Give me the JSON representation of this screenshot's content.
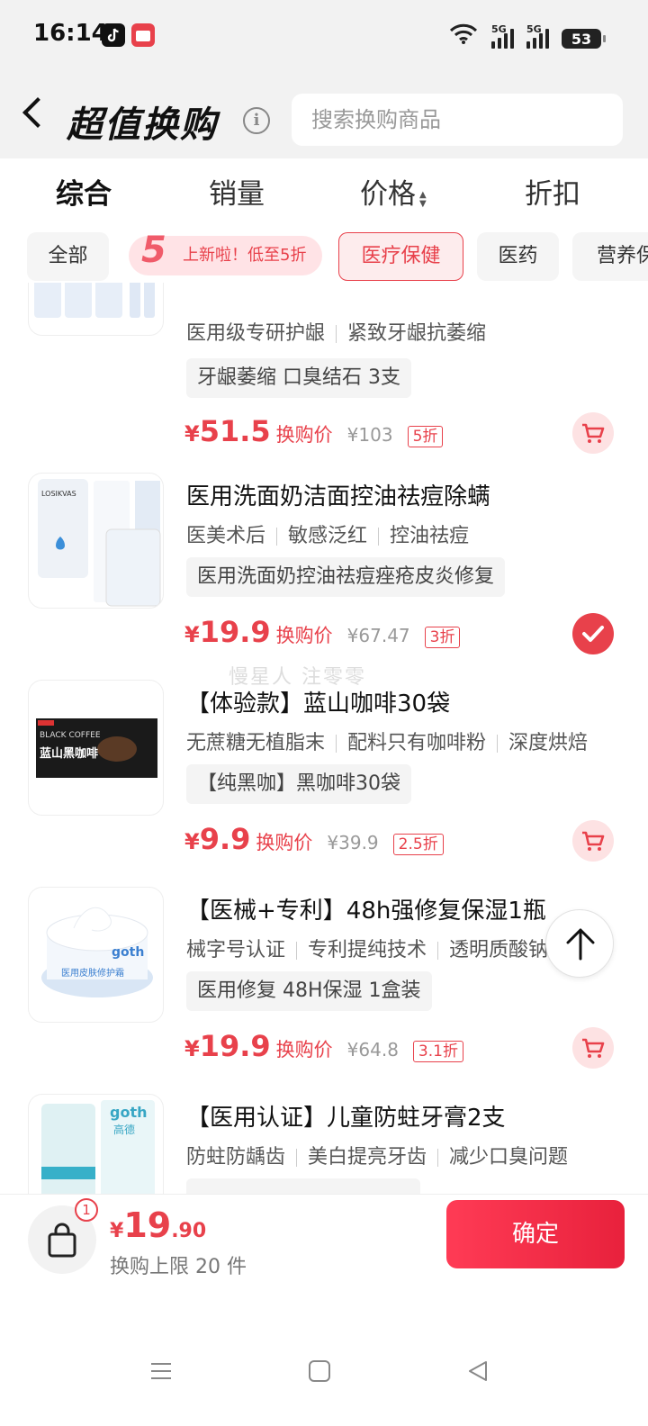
{
  "status_bar": {
    "time": "16:14",
    "battery": "53",
    "signal1": "5G",
    "signal2": "5G"
  },
  "header": {
    "title": "超值换购",
    "info_icon": "info-icon",
    "search_placeholder": "搜索换购商品"
  },
  "sort_tabs": [
    {
      "label": "综合",
      "active": true
    },
    {
      "label": "销量",
      "active": false
    },
    {
      "label": "价格",
      "active": false
    },
    {
      "label": "折扣",
      "active": false
    }
  ],
  "categories": {
    "all": "全部",
    "promo": "上新啦！低至5折",
    "promo_badge": "5",
    "medical": "医疗保健",
    "medicine": "医药",
    "nutrition": "营养保"
  },
  "products": [
    {
      "name": "",
      "tags": [
        "医用级专研护龈",
        "紧致牙龈抗萎缩"
      ],
      "chip": "牙龈萎缩 口臭结石 3支",
      "price_int": "51.5",
      "price_label": "换购价",
      "orig_price": "¥103",
      "discount": "5折",
      "selected": false
    },
    {
      "name": "医用洗面奶洁面控油祛痘除螨",
      "tags": [
        "医美术后",
        "敏感泛红",
        "控油祛痘"
      ],
      "chip": "医用洗面奶控油祛痘痤疮皮炎修复",
      "price_int": "19.9",
      "price_label": "换购价",
      "orig_price": "¥67.47",
      "discount": "3折",
      "selected": true
    },
    {
      "name": "【体验款】蓝山咖啡30袋",
      "tags": [
        "无蔗糖无植脂末",
        "配料只有咖啡粉",
        "深度烘焙"
      ],
      "chip": "【纯黑咖】黑咖啡30袋",
      "price_int": "9.9",
      "price_label": "换购价",
      "orig_price": "¥39.9",
      "discount": "2.5折",
      "selected": false
    },
    {
      "name": "【医械+专利】48h强修复保湿1瓶",
      "tags": [
        "械字号认证",
        "专利提纯技术",
        "透明质酸钠"
      ],
      "chip": "医用修复 48H保湿 1盒装",
      "price_int": "19.9",
      "price_label": "换购价",
      "orig_price": "¥64.8",
      "discount": "3.1折",
      "selected": false
    },
    {
      "name": "【医用认证】儿童防蛀牙膏2支",
      "tags": [
        "防蛀防龋齿",
        "美白提亮牙齿",
        "减少口臭问题"
      ],
      "chip": "",
      "price_int": "",
      "price_label": "",
      "orig_price": "",
      "discount": "",
      "selected": false
    }
  ],
  "thumb_text": {
    "p2_brand": "LOSIKVAS",
    "p3_line1": "BLACK COFFEE",
    "p3_line2": "蓝山黑咖啡",
    "p4_brand": "goth",
    "p4_label": "医用皮肤修护霜",
    "p5_brand": "goth",
    "p5_sub": "高德"
  },
  "watermark": "慢星人 注零零",
  "footer": {
    "badge_count": "1",
    "currency": "¥",
    "total_int": "19",
    "total_dec": ".90",
    "limit_text": "换购上限 20 件",
    "confirm_label": "确定"
  },
  "colors": {
    "accent": "#e8414b",
    "background_top": "#f2f2f2"
  }
}
